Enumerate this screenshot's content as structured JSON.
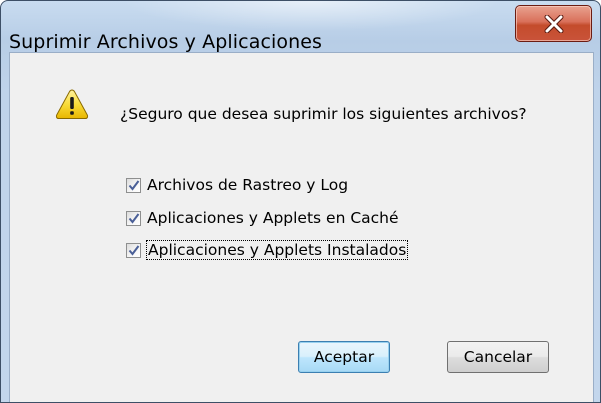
{
  "window": {
    "title": "Suprimir Archivos y Aplicaciones",
    "close_icon": "close-x-icon"
  },
  "dialog": {
    "icon": "warning-icon",
    "question": "¿Seguro que desea suprimir los siguientes archivos?",
    "options": [
      {
        "label": "Archivos de Rastreo y Log",
        "checked": true
      },
      {
        "label": "Aplicaciones y Applets en Caché",
        "checked": true
      },
      {
        "label": "Aplicaciones y Applets Instalados",
        "checked": true,
        "focused": true
      }
    ]
  },
  "buttons": {
    "ok_label": "Aceptar",
    "cancel_label": "Cancelar"
  },
  "colors": {
    "accent": "#3c7fb1",
    "close_red": "#c44c2c",
    "warning_yellow": "#f7d335"
  }
}
